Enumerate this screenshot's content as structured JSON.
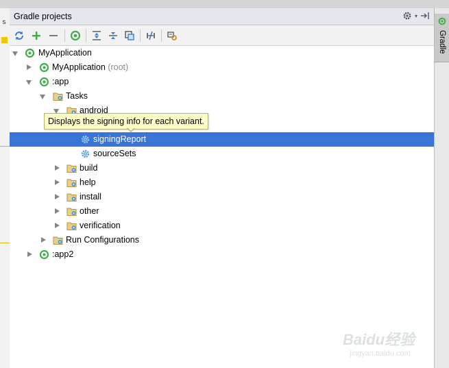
{
  "panel": {
    "title": "Gradle projects",
    "left_tab_fragment": "s"
  },
  "toolbar": {
    "buttons": [
      {
        "name": "refresh-icon"
      },
      {
        "name": "add-icon"
      },
      {
        "name": "remove-icon"
      },
      {
        "name": "execute-task-icon"
      },
      {
        "name": "expand-all-icon"
      },
      {
        "name": "collapse-all-icon"
      },
      {
        "name": "attach-project-icon"
      },
      {
        "name": "toggle-offline-icon"
      },
      {
        "name": "settings-icon"
      }
    ]
  },
  "tree": {
    "root": "MyApplication",
    "myapp_root_name": "MyApplication",
    "myapp_root_suffix": "(root)",
    "app": ":app",
    "tasks": "Tasks",
    "android": "android",
    "signingReport": "signingReport",
    "sourceSets": "sourceSets",
    "build": "build",
    "help": "help",
    "install": "install",
    "other": "other",
    "verification": "verification",
    "run_configurations": "Run Configurations",
    "app2": ":app2"
  },
  "tooltip": {
    "text": "Displays the signing info for each variant."
  },
  "right_strip": {
    "gradle_tab": "Gradle"
  },
  "watermark": {
    "logo": "Baidu经验",
    "url": "jingyan.baidu.com"
  },
  "colors": {
    "selection": "#3875d7",
    "gradle_green": "#3fae49",
    "tooltip_bg": "#fdfdc8",
    "folder": "#d9b66a",
    "gear_blue": "#4e9fd6"
  }
}
